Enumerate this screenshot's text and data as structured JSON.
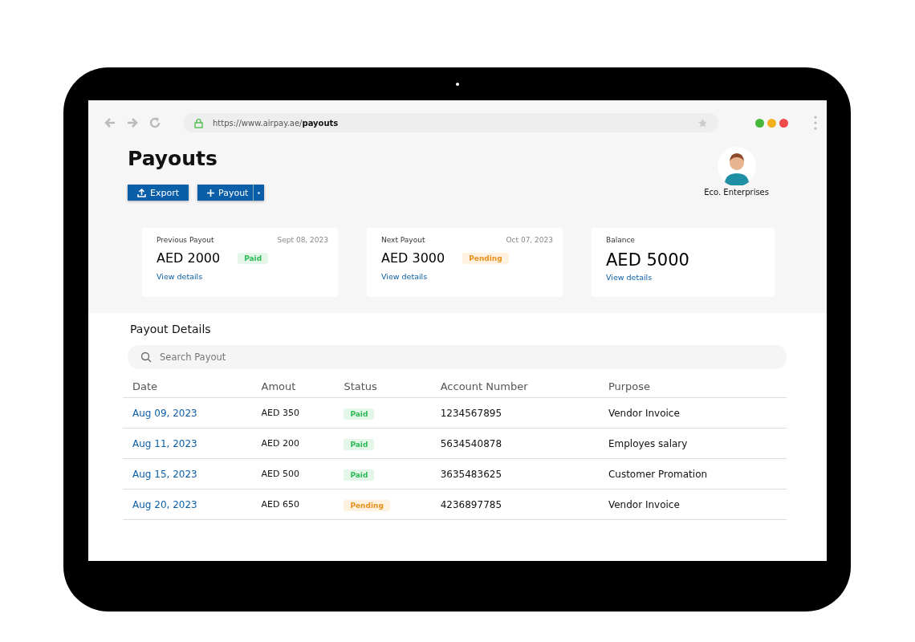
{
  "browser": {
    "url_base": "https://www.airpay.ae/",
    "url_path": "payouts"
  },
  "page": {
    "title": "Payouts",
    "buttons": [
      {
        "label": "Export",
        "kind": "export"
      },
      {
        "label": "Payout",
        "kind": "split"
      }
    ],
    "account": {
      "name": "Eco. Enterprises"
    }
  },
  "cards": [
    {
      "label": "Previous Payout",
      "date": "Sept 08, 2023",
      "amount": "AED 2000",
      "status": {
        "text": "Paid",
        "kind": "paid"
      },
      "link": "View details",
      "kind": "payout"
    },
    {
      "label": "Next Payout",
      "date": "Oct 07, 2023",
      "amount": "AED 3000",
      "status": {
        "text": "Pending",
        "kind": "pending"
      },
      "link": "View details",
      "kind": "payout"
    },
    {
      "label": "Balance",
      "amount": "AED 5000",
      "link": "View details",
      "kind": "balance"
    }
  ],
  "details": {
    "title": "Payout Details",
    "search": {
      "placeholder": "Search Payout"
    },
    "columns": [
      "Date",
      "Amout",
      "Status",
      "Account Number",
      "Purpose"
    ],
    "rows": [
      {
        "date": "Aug 09, 2023",
        "amount": "AED 350",
        "status": {
          "text": "Paid",
          "kind": "paid"
        },
        "account": "1234567895",
        "purpose": "Vendor Invoice"
      },
      {
        "date": "Aug 11, 2023",
        "amount": "AED 200",
        "status": {
          "text": "Paid",
          "kind": "paid"
        },
        "account": "5634540878",
        "purpose": "Employes salary"
      },
      {
        "date": "Aug 15, 2023",
        "amount": "AED 500",
        "status": {
          "text": "Paid",
          "kind": "paid"
        },
        "account": "3635483625",
        "purpose": "Customer Promation"
      },
      {
        "date": "Aug 20, 2023",
        "amount": "AED 650",
        "status": {
          "text": "Pending",
          "kind": "pending"
        },
        "account": "4236897785",
        "purpose": "Vendor Invoice"
      }
    ]
  }
}
